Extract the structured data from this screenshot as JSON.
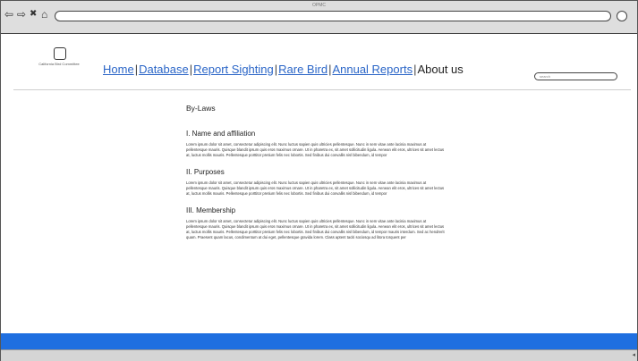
{
  "window": {
    "title": "OPMC"
  },
  "browser": {
    "icons": [
      "back-arrow-icon",
      "forward-arrow-icon",
      "stop-icon",
      "home-icon"
    ],
    "back_glyph": "⇦",
    "forward_glyph": "⇨",
    "stop_glyph": "✖",
    "home_glyph": "⌂"
  },
  "header": {
    "logo_text": "California Bird Committee",
    "search_placeholder": "search"
  },
  "nav": {
    "items": [
      "Home",
      "Database",
      "Report Sighting",
      "Rare Bird",
      "Annual Reports"
    ],
    "current": "About us",
    "separator": "|"
  },
  "content": {
    "title": "By-Laws",
    "sections": [
      {
        "heading": "I. Name and affiliation",
        "body": "Lorem ipsum dolor sit amet, consectetur adipiscing elit. Nunc luctus sapien quis ultricies pellentesque. Nunc in sem vitae ante lacinia maximus at pellentesque mauris. Quisque blandit ipsum quis eros maximus ornare. Ut in pharetra ex, sit amet sollicitudin ligula. Aenean elit eros, ultrices sit amet lectus at, luctus mollis mauris. Pellentesque porttitor pretium felis nec lobortis. Sed finibus dui convallis nisl bibendum, id tempor"
      },
      {
        "heading": "II. Purposes",
        "body": "Lorem ipsum dolor sit amet, consectetur adipiscing elit. Nunc luctus sapien quis ultricies pellentesque. Nunc in sem vitae ante lacinia maximus at pellentesque mauris. Quisque blandit ipsum quis eros maximus ornare. Ut in pharetra ex, sit amet sollicitudin ligula. Aenean elit eros, ultrices sit amet lectus at, luctus mollis mauris. Pellentesque porttitor pretium felis nec lobortis. Sed finibus dui convallis nisl bibendum, id tempor"
      },
      {
        "heading": "III. Membership",
        "body": "Lorem ipsum dolor sit amet, consectetur adipiscing elit. Nunc luctus sapien quis ultricies pellentesque. Nunc in sem vitae ante lacinia maximus at pellentesque mauris. Quisque blandit ipsum quis eros maximus ornare. Ut in pharetra ex, sit amet sollicitudin ligula. Aenean elit eros, ultrices sit amet lectus at, luctus mollis mauris. Pellentesque porttitor pretium felis nec lobortis. Sed finibus dui convallis nisl bibendum, id tempor mauris interdum. Sed ac hendrerit quam. Praesent quam lacus, condimentum at dui eget, pellentesque gravida lorem. Class aptent taciti sociosqu ad litora torquent per"
      }
    ]
  },
  "colors": {
    "footer": "#1f6fe0",
    "link": "#2a65c7"
  }
}
